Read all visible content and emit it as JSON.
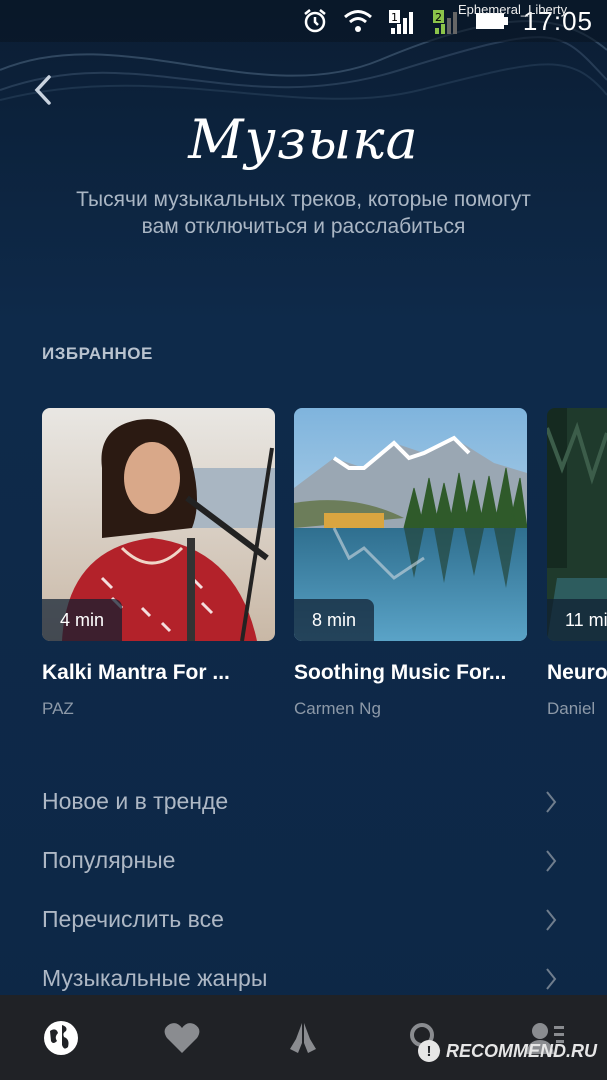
{
  "status_bar": {
    "time": "17:05",
    "carrier": "Ephemeral_Liberty",
    "sim1_label": "1",
    "sim2_label": "2",
    "icons": [
      "alarm-icon",
      "wifi-icon",
      "signal-sim1-icon",
      "signal-sim2-icon",
      "battery-icon"
    ]
  },
  "header": {
    "back_icon": "chevron-left-icon",
    "title": "Музыка",
    "subtitle": "Тысячи музыкальных треков, которые помогут вам отключиться и расслабиться"
  },
  "favorites": {
    "label": "ИЗБРАННОЕ",
    "cards": [
      {
        "duration": "4 min",
        "title": "Kalki Mantra For ...",
        "author": "PAZ"
      },
      {
        "duration": "8 min",
        "title": "Soothing Music For...",
        "author": "Carmen Ng"
      },
      {
        "duration": "11 mi",
        "title": "Neuro",
        "author": "Daniel"
      }
    ]
  },
  "menu": [
    {
      "label": "Новое и в тренде"
    },
    {
      "label": "Популярные"
    },
    {
      "label": "Перечислить все"
    },
    {
      "label": "Музыкальные жанры"
    }
  ],
  "bottom_nav": {
    "items": [
      "globe-icon",
      "heart-icon",
      "praying-hands-icon",
      "search-icon",
      "profile-icon"
    ],
    "active": "globe-icon"
  },
  "watermark": {
    "text": "RECOMMEND.RU"
  },
  "colors": {
    "background": "#0e2a4a",
    "nav_background": "#202226",
    "muted_text": "#aeb8c5"
  }
}
